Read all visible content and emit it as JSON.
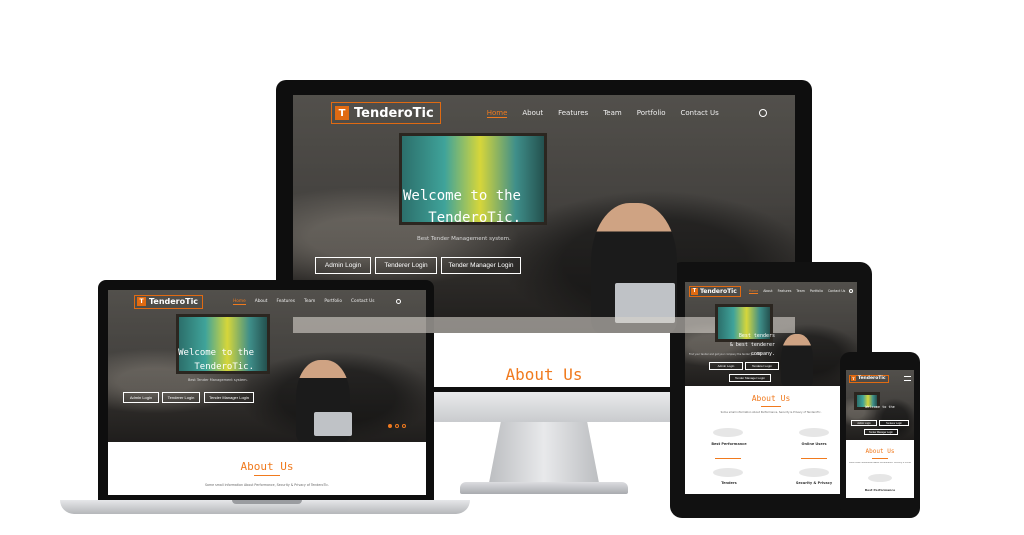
{
  "brand": {
    "name": "TenderoTic",
    "accent": "#f07a1e"
  },
  "nav": {
    "items": [
      "Home",
      "About",
      "Features",
      "Team",
      "Portfolio",
      "Contact Us"
    ],
    "active": "Home"
  },
  "hero": {
    "welcome_line1": "Welcome to the",
    "welcome_line2": "TenderoTic.",
    "tagline": "Best Tender Management system.",
    "buttons": [
      "Admin Login",
      "Tenderer Login",
      "Tender Manager Login"
    ]
  },
  "about": {
    "title": "About Us",
    "intro": "Some small information About Performance, Security & Privacy of TenderoTic."
  },
  "tablet": {
    "hero_line1": "Best tenders",
    "hero_line2": "& best tenderer company.",
    "hero_sub": "Find your tender and get your company the tender you want.",
    "features": [
      {
        "title": "Best Performance",
        "icon": "thumbs-up-icon"
      },
      {
        "title": "Online Users",
        "icon": "users-icon"
      },
      {
        "title": "Tenders",
        "icon": "document-icon"
      },
      {
        "title": "Security & Privacy",
        "icon": "lock-icon"
      }
    ]
  },
  "phone": {
    "hero_line1": "Welcome to the",
    "feature_title": "Best Performance"
  }
}
